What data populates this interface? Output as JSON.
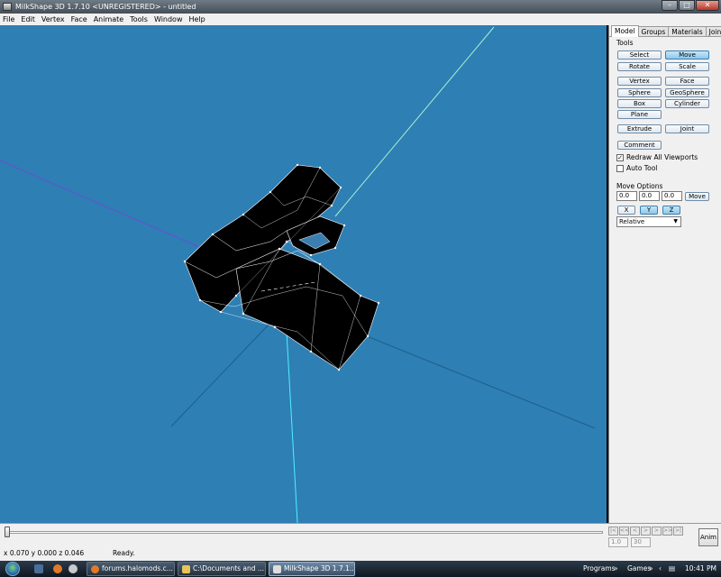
{
  "window": {
    "title": "MilkShape 3D 1.7.10 <UNREGISTERED> - untitled",
    "minimize_icon": "minimize-icon",
    "maximize_icon": "maximize-icon",
    "close_icon": "close-icon"
  },
  "menu": [
    "File",
    "Edit",
    "Vertex",
    "Face",
    "Animate",
    "Tools",
    "Window",
    "Help"
  ],
  "tabs": [
    "Model",
    "Groups",
    "Materials",
    "Joints"
  ],
  "panel": {
    "tools_label": "Tools",
    "buttons": {
      "select": "Select",
      "move": "Move",
      "rotate": "Rotate",
      "scale": "Scale",
      "vertex": "Vertex",
      "face": "Face",
      "sphere": "Sphere",
      "geosphere": "GeoSphere",
      "box": "Box",
      "cylinder": "Cylinder",
      "plane": "Plane",
      "extrude": "Extrude",
      "joint": "Joint",
      "comment": "Comment"
    },
    "redraw_all": "Redraw All Viewports",
    "redraw_checked": true,
    "auto_tool": "Auto Tool",
    "auto_tool_checked": false,
    "move_options_label": "Move Options",
    "move_x": "0.0",
    "move_y": "0.0",
    "move_z": "0.0",
    "move_button": "Move",
    "axis_x": "X",
    "axis_y": "Y",
    "axis_z": "Z",
    "mode": "Relative"
  },
  "timeline": {
    "start_frame": "1.0",
    "end_frame": "30",
    "anim_button": "Anim"
  },
  "status": {
    "coords": "x 0.070 y 0.000 z 0.046",
    "text": "Ready."
  },
  "taskbar": {
    "tasks": [
      "forums.halomods.c...",
      "C:\\Documents and ...",
      "MilkShape 3D 1.7.1..."
    ],
    "programs": "Programs",
    "games": "Games",
    "clock": "10:41 PM"
  },
  "colors": {
    "viewport_bg": "#2e7fb4",
    "mesh": "#000000",
    "wire": "#ffffff"
  }
}
